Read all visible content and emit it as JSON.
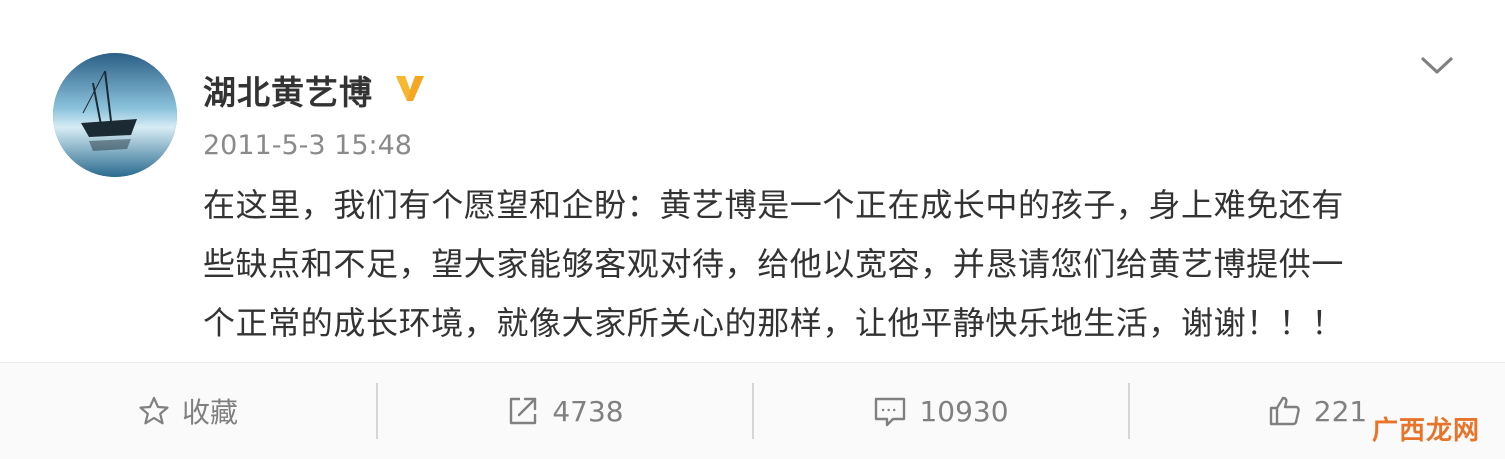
{
  "post": {
    "username": "湖北黄艺博",
    "timestamp": "2011-5-3 15:48",
    "content_lines": [
      "在这里，我们有个愿望和企盼：黄艺博是一个正在成长中的孩子，身上难免还有",
      "些缺点和不足，望大家能够客观对待，给他以宽容，并恳请您们给黄艺博提供一",
      "个正常的成长环境，就像大家所关心的那样，让他平静快乐地生活，谢谢！！！"
    ],
    "verified_badge": "verified-v-icon",
    "menu_icon": "chevron-down-icon"
  },
  "actions": {
    "favorite": {
      "icon": "star-icon",
      "label": "收藏"
    },
    "repost": {
      "icon": "share-icon",
      "label": "4738"
    },
    "comment": {
      "icon": "comment-icon",
      "label": "10930"
    },
    "like": {
      "icon": "thumbs-up-icon",
      "label": "221"
    }
  },
  "watermark": "广西龙网",
  "colors": {
    "accent_badge": "#f5a623",
    "text_primary": "#333333",
    "text_muted": "#808080",
    "watermark": "#e8742a"
  }
}
